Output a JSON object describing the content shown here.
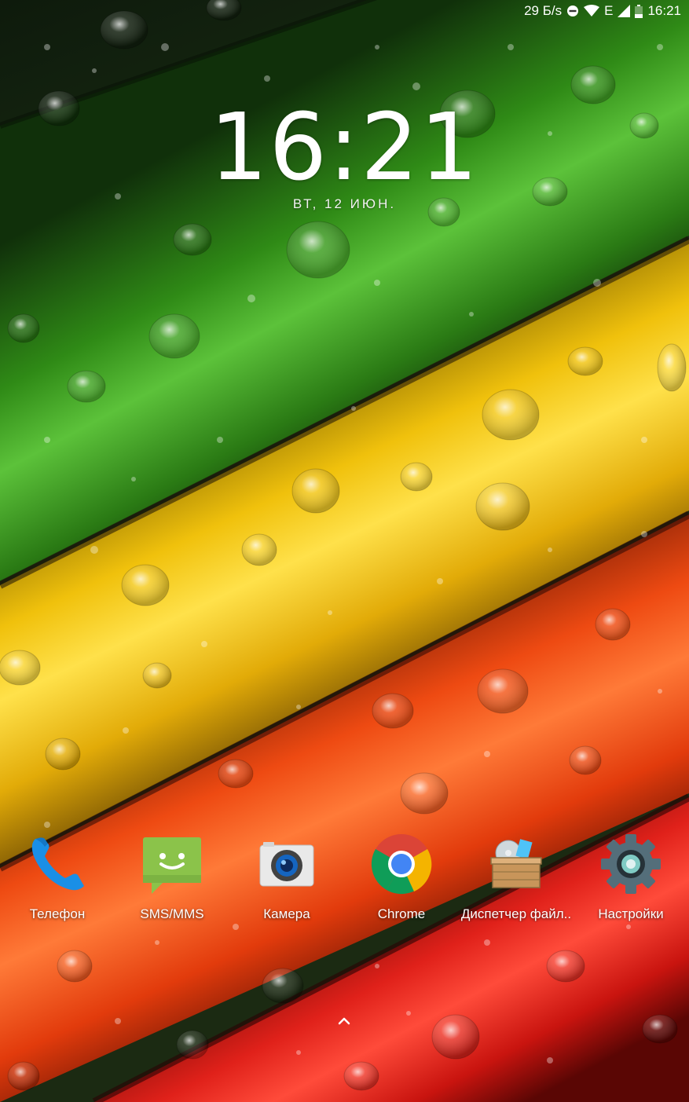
{
  "status_bar": {
    "network_speed": "29 Б/s",
    "network_type": "E",
    "time": "16:21",
    "icons": [
      "do-not-disturb-icon",
      "wifi-icon",
      "signal-icon",
      "battery-icon"
    ]
  },
  "clock": {
    "time": "16:21",
    "date": "ВТ, 12 ИЮН."
  },
  "dock": {
    "apps": [
      {
        "label": "Телефон",
        "icon": "phone-icon"
      },
      {
        "label": "SMS/MMS",
        "icon": "sms-icon"
      },
      {
        "label": "Камера",
        "icon": "camera-icon"
      },
      {
        "label": "Chrome",
        "icon": "chrome-icon"
      },
      {
        "label": "Диспетчер файл..",
        "icon": "file-manager-icon"
      },
      {
        "label": "Настройки",
        "icon": "settings-icon"
      }
    ]
  },
  "app_drawer_handle": {
    "icon": "chevron-up-icon"
  },
  "colors": {
    "green": "#3a9a1e",
    "yellow": "#f2c10d",
    "orange": "#f2541a",
    "red": "#e01e1e"
  }
}
